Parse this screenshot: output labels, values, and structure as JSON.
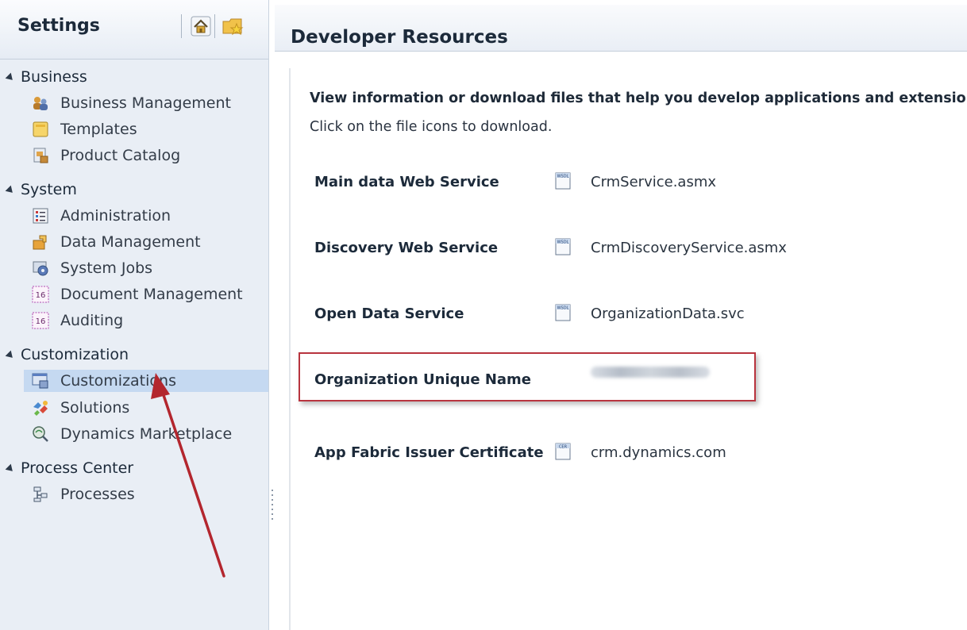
{
  "sidebar": {
    "title": "Settings",
    "groups": [
      {
        "label": "Business",
        "items": [
          {
            "label": "Business Management",
            "icon": "business-management-icon"
          },
          {
            "label": "Templates",
            "icon": "templates-icon"
          },
          {
            "label": "Product Catalog",
            "icon": "product-catalog-icon"
          }
        ]
      },
      {
        "label": "System",
        "items": [
          {
            "label": "Administration",
            "icon": "administration-icon"
          },
          {
            "label": "Data Management",
            "icon": "data-management-icon"
          },
          {
            "label": "System Jobs",
            "icon": "system-jobs-icon"
          },
          {
            "label": "Document Management",
            "icon": "calendar-16-icon"
          },
          {
            "label": "Auditing",
            "icon": "calendar-16-icon"
          }
        ]
      },
      {
        "label": "Customization",
        "items": [
          {
            "label": "Customizations",
            "icon": "customizations-icon",
            "selected": true
          },
          {
            "label": "Solutions",
            "icon": "solutions-icon"
          },
          {
            "label": "Dynamics Marketplace",
            "icon": "marketplace-icon"
          }
        ]
      },
      {
        "label": "Process Center",
        "items": [
          {
            "label": "Processes",
            "icon": "processes-icon"
          }
        ]
      }
    ],
    "icon_badge_text": "16"
  },
  "main": {
    "title": "Developer Resources",
    "intro_bold": "View information or download files that help you develop applications and extensions",
    "intro_hint": "Click on the file icons to download.",
    "resources": [
      {
        "label": "Main data Web Service",
        "file": "CrmService.asmx"
      },
      {
        "label": "Discovery Web Service",
        "file": "CrmDiscoveryService.asmx"
      },
      {
        "label": "Open Data Service",
        "file": "OrganizationData.svc"
      },
      {
        "label": "Organization Unique Name",
        "file": ""
      },
      {
        "label": "App Fabric Issuer Certificate",
        "file": "crm.dynamics.com"
      }
    ]
  },
  "colors": {
    "selected_bg": "#c5d9f1",
    "highlight_border": "#b8343e",
    "arrow": "#b3262e"
  }
}
